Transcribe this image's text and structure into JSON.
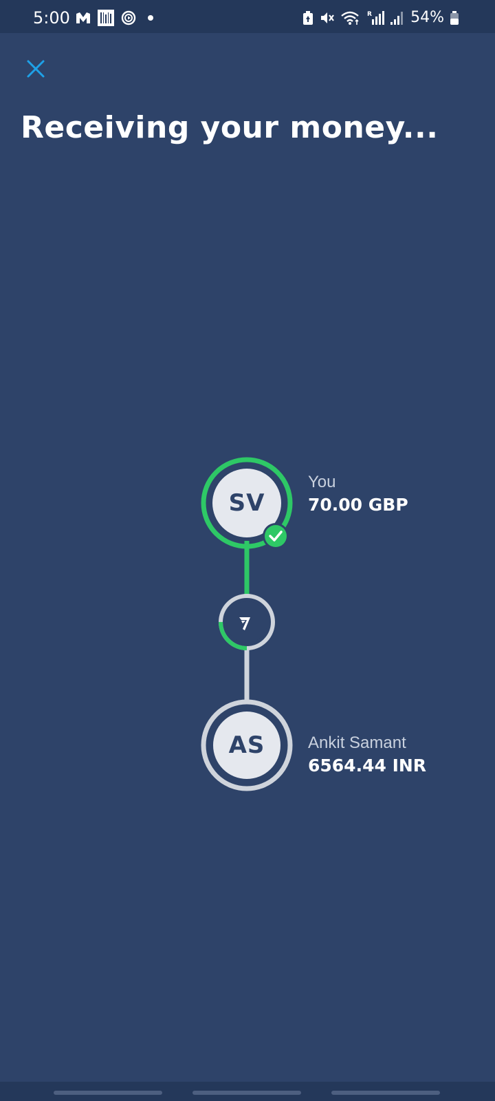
{
  "status_bar": {
    "time": "5:00",
    "left_icons": [
      "m-logo-icon",
      "barcode-icon",
      "play-circle-icon",
      "dot-icon"
    ],
    "right_icons": [
      "battery-saver-icon",
      "mute-icon",
      "wifi-icon",
      "signal-r-icon",
      "signal-icon",
      "battery-icon"
    ],
    "battery": "54%"
  },
  "header": {
    "close_icon": "close-icon",
    "title": "Receiving your money..."
  },
  "transfer": {
    "sender": {
      "initials": "SV",
      "label": "You",
      "amount": "70.00 GBP",
      "status": "complete"
    },
    "provider": {
      "icon": "wise-logo-icon",
      "progress": 0.25
    },
    "recipient": {
      "initials": "AS",
      "label": "Ankit Samant",
      "amount": "6564.44 INR",
      "status": "pending"
    }
  },
  "colors": {
    "background": "#2e4369",
    "status_bar": "#24385a",
    "accent_green": "#2ec866",
    "pending_grey": "#cfd4dc",
    "close_icon": "#1ea1e8",
    "node_fill": "#e5e8ee"
  }
}
